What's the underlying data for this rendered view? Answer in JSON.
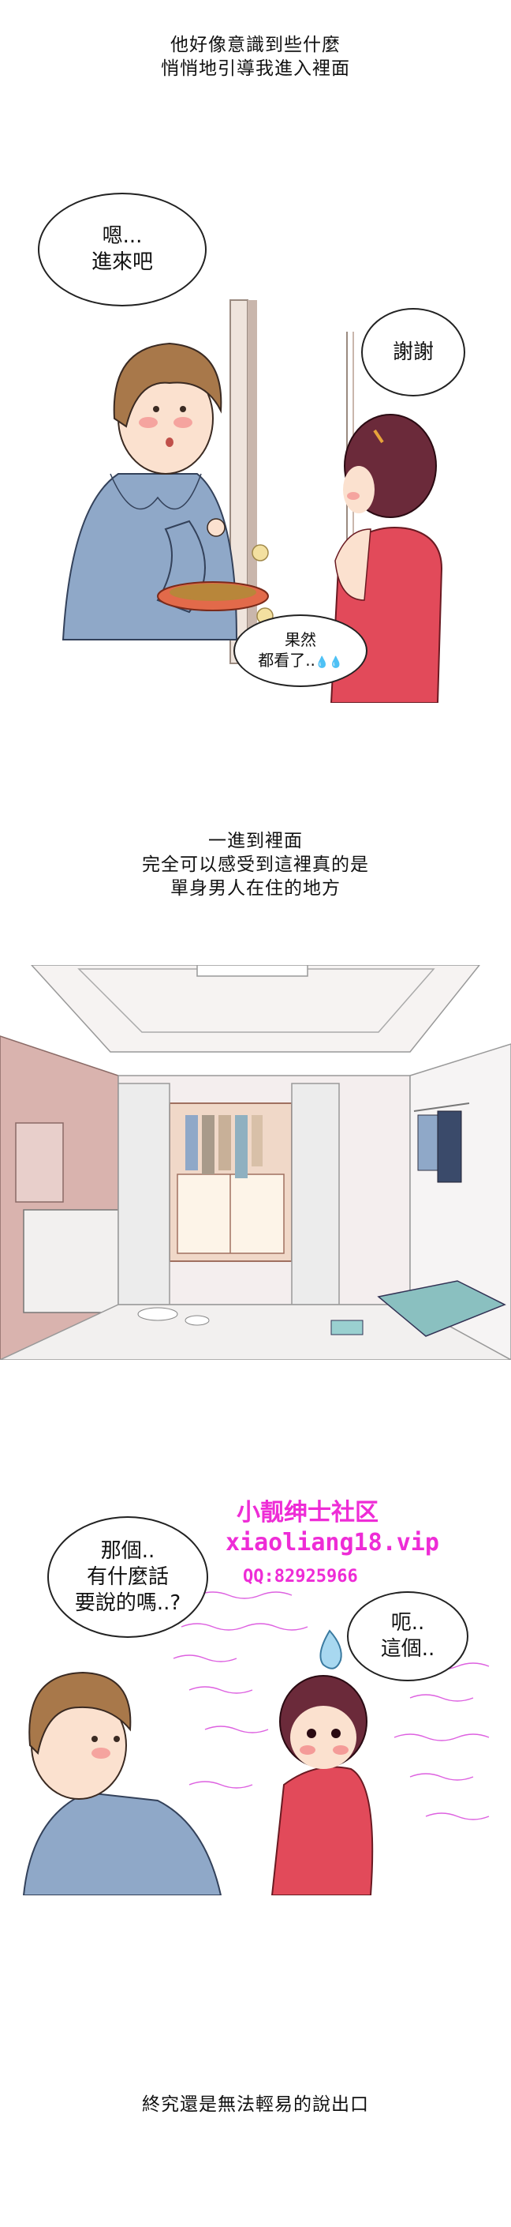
{
  "caption_1": {
    "line_1": "他好像意識到些什麼",
    "line_2": "悄悄地引導我進入裡面"
  },
  "panel_1": {
    "bubble_man": {
      "line_1": "嗯...",
      "line_2": "進來吧"
    },
    "bubble_girl": {
      "line_1": "謝謝"
    },
    "bubble_thought": {
      "line_1": "果然",
      "line_2": "都看了..",
      "drops": "💧💧"
    }
  },
  "caption_2": {
    "line_1": "一進到裡面",
    "line_2": "完全可以感受到這裡真的是",
    "line_3": "單身男人在住的地方"
  },
  "panel_3": {
    "bubble_man": {
      "line_1": "那個..",
      "line_2": "有什麼話",
      "line_3": "要說的嗎..?"
    },
    "bubble_girl": {
      "line_1": "呃..",
      "line_2": "這個.."
    },
    "watermark": {
      "line_1": "小靓绅士社区",
      "line_2": "xiaoliang18.vip",
      "line_3": "QQ:82925966"
    }
  },
  "caption_4": {
    "line_1": "終究還是無法輕易的說出口"
  },
  "colors": {
    "shirt": "#8fa8c8",
    "hair_man": "#a8784a",
    "hair_girl": "#6b2a3a",
    "dress": "#e24a5a",
    "skin": "#fbe1cf",
    "blush": "#f28a8a",
    "watermark": "#ee2cd6"
  }
}
